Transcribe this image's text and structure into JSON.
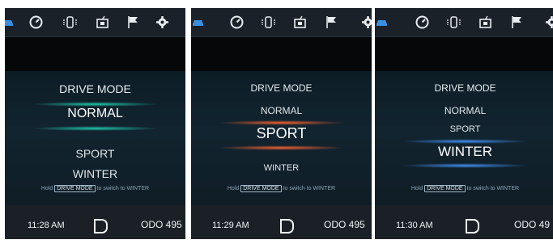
{
  "colors": {
    "normal_glow": "#19b39a",
    "sport_glow": "#e0532a",
    "winter_glow": "#3a86e0"
  },
  "panels": [
    {
      "title": "DRIVE MODE",
      "options": [
        "NORMAL",
        "SPORT",
        "WINTER"
      ],
      "selected": "NORMAL",
      "hint_prefix": "Hold",
      "hint_key": "DRIVE MODE",
      "hint_suffix": "to switch to WINTER",
      "time": "11:28 AM",
      "gear": "D",
      "odo": "ODO 495"
    },
    {
      "title": "DRIVE MODE",
      "options": [
        "NORMAL",
        "SPORT",
        "WINTER"
      ],
      "selected": "SPORT",
      "hint_prefix": "Hold",
      "hint_key": "DRIVE MODE",
      "hint_suffix": "to switch to WINTER",
      "time": "11:29 AM",
      "gear": "D",
      "odo": "ODO 495"
    },
    {
      "title": "DRIVE MODE",
      "options": [
        "NORMAL",
        "SPORT",
        "WINTER"
      ],
      "selected": "WINTER",
      "hint_prefix": "Hold",
      "hint_key": "DRIVE MODE",
      "hint_suffix": "to switch to WINTER",
      "time": "11:30 AM",
      "gear": "D",
      "odo": "ODO 49"
    }
  ],
  "topbar_icons": [
    "car-icon",
    "speedometer-icon",
    "seat-icon",
    "camera-icon",
    "flag-icon",
    "gear-icon"
  ]
}
